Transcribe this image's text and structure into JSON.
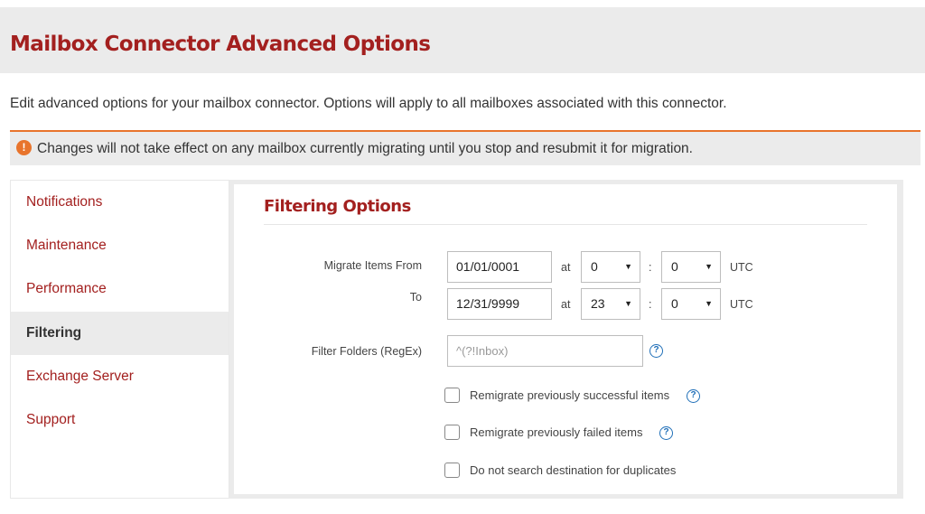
{
  "header": {
    "title": "Mailbox Connector Advanced Options"
  },
  "intro": {
    "text": "Edit advanced options for your mailbox connector. Options will apply to all mailboxes associated with this connector."
  },
  "warning": {
    "icon": "exclamation-icon",
    "text": "Changes will not take effect on any mailbox currently migrating until you stop and resubmit it for migration.",
    "accent_color": "#e8742c"
  },
  "sidebar": {
    "items": [
      {
        "label": "Notifications",
        "active": false
      },
      {
        "label": "Maintenance",
        "active": false
      },
      {
        "label": "Performance",
        "active": false
      },
      {
        "label": "Filtering",
        "active": true
      },
      {
        "label": "Exchange Server",
        "active": false
      },
      {
        "label": "Support",
        "active": false
      }
    ]
  },
  "filtering": {
    "title": "Filtering Options",
    "from": {
      "label": "Migrate Items From",
      "date": "01/01/0001",
      "at": "at",
      "hour": "0",
      "minute": "0",
      "sep": ":",
      "tz": "UTC"
    },
    "to": {
      "label": "To",
      "date": "12/31/9999",
      "at": "at",
      "hour": "23",
      "minute": "0",
      "sep": ":",
      "tz": "UTC"
    },
    "folders": {
      "label": "Filter Folders (RegEx)",
      "placeholder": "^(?!Inbox)"
    },
    "checkboxes": [
      {
        "label": "Remigrate previously successful items",
        "checked": false,
        "help": true
      },
      {
        "label": "Remigrate previously failed items",
        "checked": false,
        "help": true
      },
      {
        "label": "Do not search destination for duplicates",
        "checked": false,
        "help": false
      }
    ]
  },
  "colors": {
    "brand": "#a3201f",
    "help": "#1f6fb8",
    "accent": "#e8742c"
  }
}
